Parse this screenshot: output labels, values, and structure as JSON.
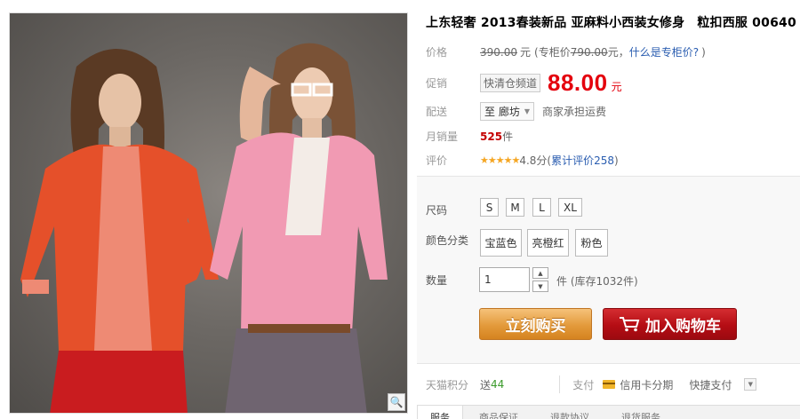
{
  "product": {
    "title_main": "上东轻奢 2013春装新品 亚麻料小西装女修身",
    "title_tail": "粒扣西服 00640"
  },
  "price": {
    "label": "价格",
    "original": "390.00",
    "yuan": "元",
    "counter_note_prefix": "(专柜价",
    "counter_price": "790.00",
    "counter_note_suffix": "元，",
    "counter_link": "什么是专柜价?",
    "close_paren": ")"
  },
  "promo": {
    "label": "促销",
    "tag": "快清仓频道",
    "price": "88.00",
    "yuan": "元"
  },
  "shipping": {
    "label": "配送",
    "destination": "至 廊坊",
    "note": "商家承担运费"
  },
  "sales": {
    "label": "月销量",
    "count": "525",
    "unit": "件"
  },
  "rating": {
    "label": "评价",
    "stars": "★★★★★",
    "score": "4.8分",
    "reviews_prefix": "(",
    "reviews_link": "累计评价258",
    "reviews_suffix": ")"
  },
  "options": {
    "size_label": "尺码",
    "sizes": [
      "S",
      "M",
      "L",
      "XL"
    ],
    "color_label": "颜色分类",
    "colors": [
      "宝蓝色",
      "亮橙红",
      "粉色"
    ],
    "qty_label": "数量",
    "qty_value": "1",
    "stock_text": "件 (库存1032件)"
  },
  "actions": {
    "buy_now": "立刻购买",
    "add_cart": "加入购物车"
  },
  "footer": {
    "points_label": "天猫积分",
    "points_value_prefix": "送",
    "points_value": "44",
    "pay_label": "支付",
    "card_pay": "信用卡分期",
    "quick_pay": "快捷支付"
  },
  "tabs": [
    "服务",
    "商品保证",
    "退款协议",
    "退货服务"
  ],
  "icons": {
    "zoom": "magnifier-icon",
    "cart": "cart-icon",
    "card": "credit-card-icon"
  },
  "colors": {
    "price_red": "#e4000d",
    "buy_orange": "#e39a3b",
    "cart_red": "#b50d14",
    "link_blue": "#2a5db0"
  }
}
